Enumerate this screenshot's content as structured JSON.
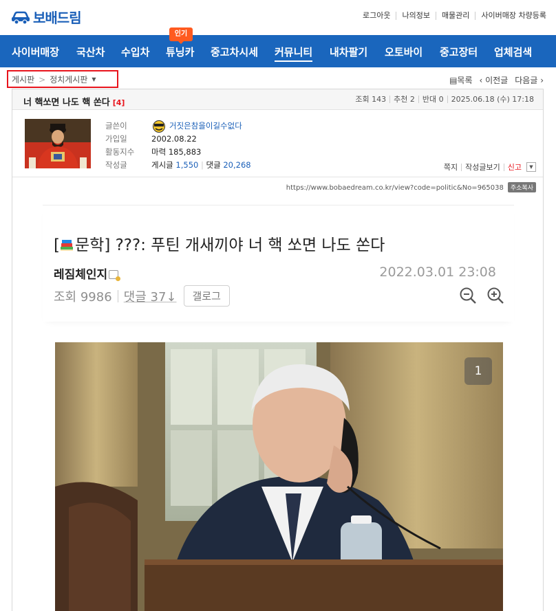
{
  "site": {
    "logo_text": "보배드림",
    "top_links": [
      "로그아웃",
      "나의정보",
      "매물관리",
      "사이버매장 차량등록"
    ]
  },
  "nav": {
    "hot_badge": "인기",
    "items": [
      "사이버매장",
      "국산차",
      "수입차",
      "튜닝카",
      "중고차시세",
      "커뮤니티",
      "내차팔기",
      "오토바이",
      "중고장터",
      "업체검색"
    ],
    "active_index": 5
  },
  "breadcrumb": {
    "root": "게시판",
    "separator": ">",
    "current": "정치게시판",
    "highlight_color": "#e8131b"
  },
  "post_nav": {
    "list": "목록",
    "prev": "이전글",
    "next": "다음글"
  },
  "post": {
    "title": "너 핵쏘면 나도 핵 쏜다",
    "comment_count": "[4]",
    "stats": [
      "조회 143",
      "추천 2",
      "반대 0",
      "2025.06.18 (수) 17:18"
    ]
  },
  "author": {
    "labels": {
      "writer": "글쓴이",
      "joined": "가입일",
      "activity": "활동지수",
      "posts": "작성글"
    },
    "nickname": "거짓은참을이길수없다",
    "joined": "2002.08.22",
    "activity": "마력 185,883",
    "posts_label": "게시글",
    "posts_count": "1,550",
    "comments_label": "댓글",
    "comments_count": "20,268",
    "actions": [
      "쪽지",
      "작성글보기",
      "신고"
    ]
  },
  "url_line": {
    "url": "https://www.bobaedream.co.kr/view?code=politic&No=965038",
    "copy_label": "주소복사"
  },
  "embed": {
    "title": "[📚문학] ???: 푸틴 개새끼야 너 핵 쏘면 나도 쏜다",
    "title_prefix": "[",
    "title_tag": "문학",
    "title_rest": "] ???: 푸틴 개새끼야 너 핵 쏘면 나도 쏜다",
    "user": "레짐체인지",
    "date": "2022.03.01 23:08",
    "views": "조회 9986",
    "comments": "댓글 37",
    "gallery_button": "갤로그",
    "photo_counter": "1"
  },
  "colors": {
    "brand_blue": "#1a66bd",
    "hot_orange": "#ff5a1f",
    "alert_red": "#e8131b"
  }
}
